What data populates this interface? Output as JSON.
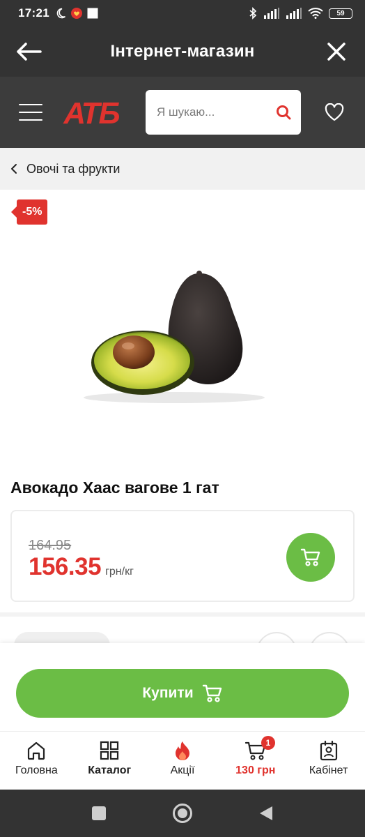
{
  "status_bar": {
    "time": "17:21",
    "battery": "59",
    "icons": [
      "moon-icon",
      "app-notification-icon",
      "square-notification-icon",
      "bluetooth-icon",
      "signal-icon",
      "signal-icon",
      "wifi-icon",
      "battery-icon"
    ]
  },
  "app_bar": {
    "title": "Інтернет-магазин",
    "back_icon": "arrow-left-icon",
    "close_icon": "close-icon"
  },
  "header": {
    "logo_text": "АТБ",
    "search_placeholder": "Я шукаю...",
    "menu_icon": "hamburger-icon",
    "favorites_icon": "heart-icon"
  },
  "breadcrumb": {
    "label": "Овочі та фрукти"
  },
  "product": {
    "discount_badge": "-5%",
    "title": "Авокадо Хаас вагове 1 гат",
    "old_price": "164.95",
    "price": "156.35",
    "unit": "грн/кг"
  },
  "buy_button": {
    "label": "Купити"
  },
  "bottom_nav": {
    "items": [
      {
        "label": "Головна",
        "icon": "home-icon"
      },
      {
        "label": "Каталог",
        "icon": "catalog-grid-icon"
      },
      {
        "label": "Акції",
        "icon": "fire-icon"
      },
      {
        "label": "130 грн",
        "icon": "cart-icon",
        "badge": "1"
      },
      {
        "label": "Кабінет",
        "icon": "profile-icon"
      }
    ]
  },
  "colors": {
    "brand_red": "#e0332e",
    "green": "#6bbd45",
    "dark_bar": "#333333"
  }
}
